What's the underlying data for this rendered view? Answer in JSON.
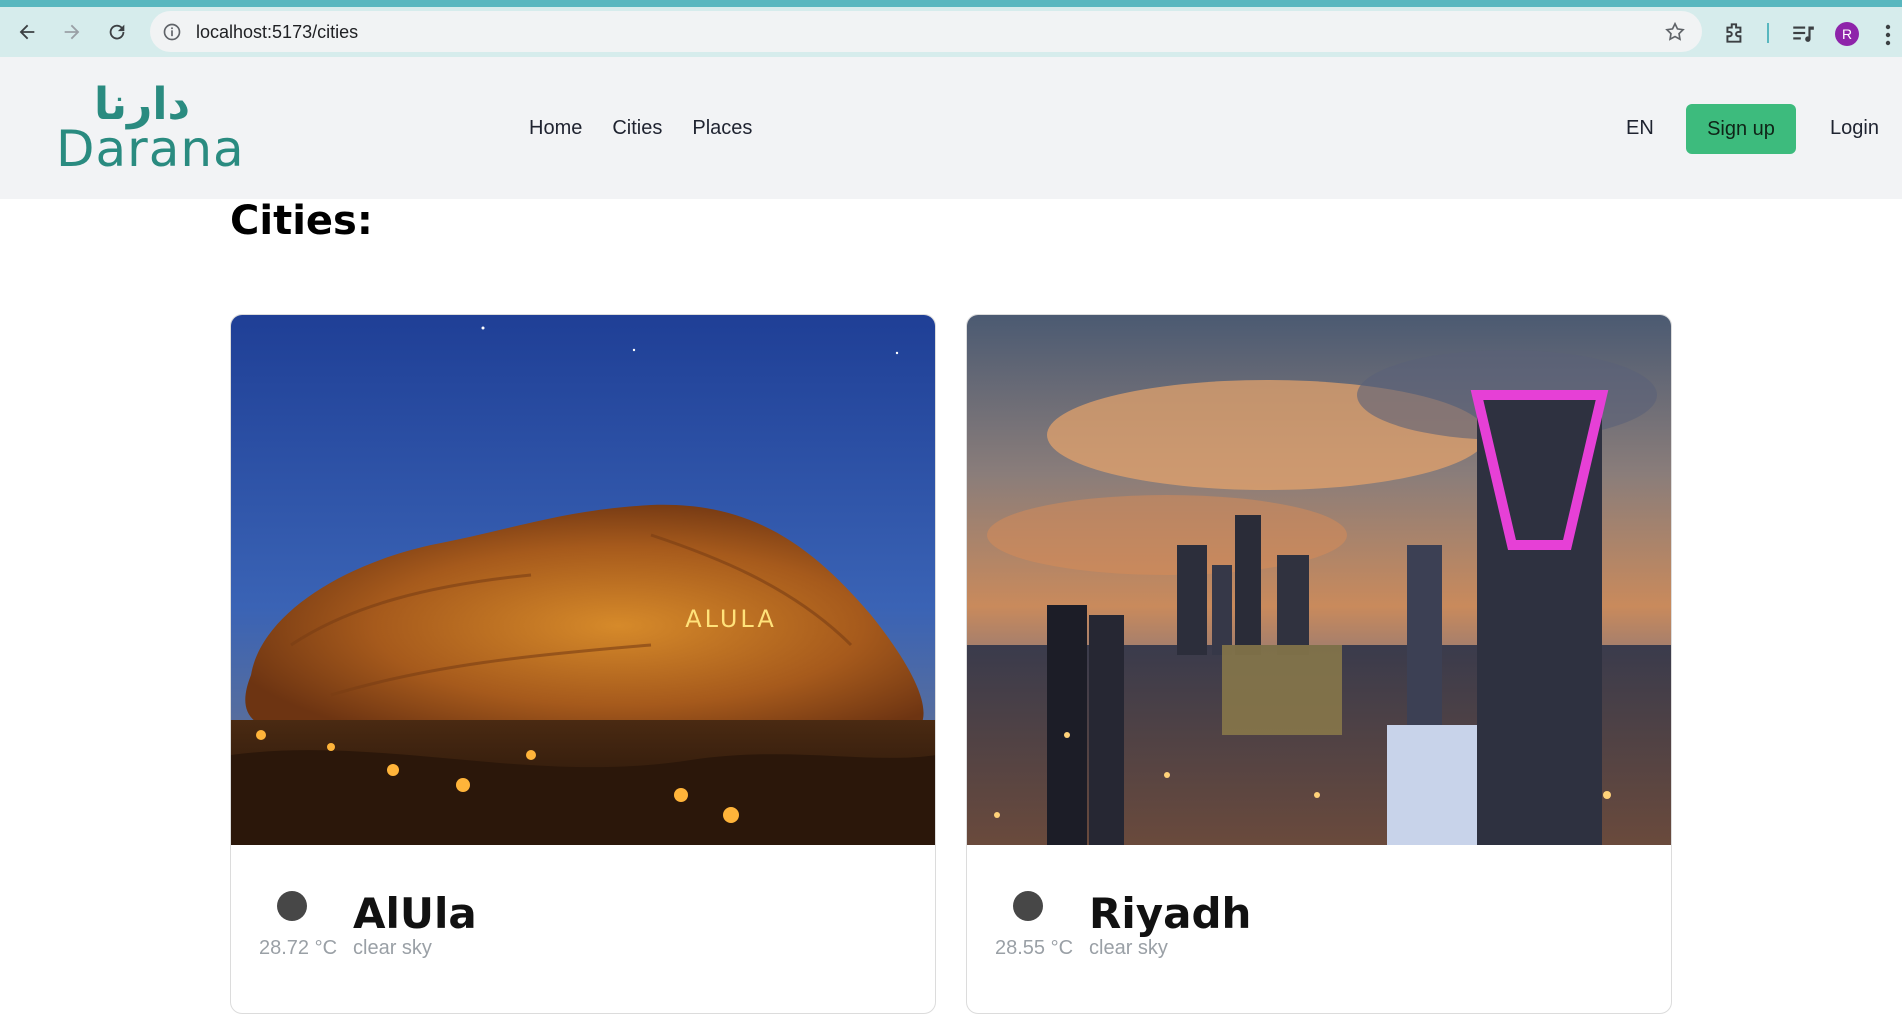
{
  "browser": {
    "url": "localhost:5173/cities",
    "profile_initial": "R",
    "icons": [
      "back-icon",
      "forward-icon",
      "reload-icon",
      "info-icon",
      "star-icon",
      "extensions-icon",
      "media-icon",
      "menu-icon"
    ]
  },
  "header": {
    "logo_arabic": "دارنا",
    "logo_text": "Darana",
    "nav": [
      {
        "label": "Home"
      },
      {
        "label": "Cities"
      },
      {
        "label": "Places"
      }
    ],
    "lang": "EN",
    "signup_label": "Sign up",
    "login_label": "Login",
    "colors": {
      "brand": "#2a8b80",
      "signup_bg": "#3dbb7d",
      "header_bg": "#f2f3f5"
    }
  },
  "main": {
    "title": "Cities:",
    "cities": [
      {
        "name": "AlUla",
        "temp": "28.72 °C",
        "desc": "clear sky",
        "image_text": "ALULA"
      },
      {
        "name": "Riyadh",
        "temp": "28.55 °C",
        "desc": "clear sky"
      }
    ]
  }
}
